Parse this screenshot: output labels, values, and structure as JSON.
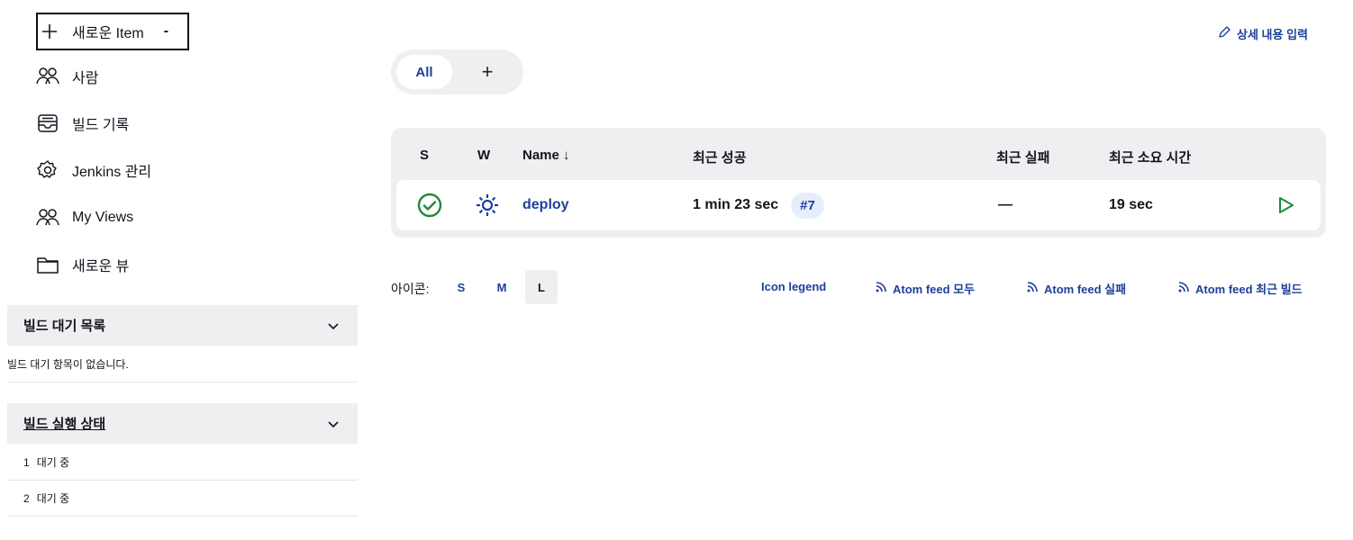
{
  "sidebar": {
    "tasks": [
      {
        "label": "새로운 Item",
        "icon": "plus-icon",
        "caret": "-"
      },
      {
        "label": "사람",
        "icon": "people-icon"
      },
      {
        "label": "빌드 기록",
        "icon": "inbox-icon"
      },
      {
        "label": "Jenkins 관리",
        "icon": "gear-icon"
      },
      {
        "label": "My Views",
        "icon": "people-icon"
      },
      {
        "label": "새로운 뷰",
        "icon": "folder-icon"
      }
    ],
    "build_queue": {
      "title": "빌드 대기 목록",
      "empty_text": "빌드 대기 항목이 없습니다."
    },
    "executors": {
      "title": "빌드 실행 상태",
      "rows": [
        {
          "num": "1",
          "label": "대기 중"
        },
        {
          "num": "2",
          "label": "대기 중"
        }
      ]
    }
  },
  "main": {
    "edit_description": "상세 내용 입력",
    "tabs": {
      "all": "All",
      "add": "+"
    },
    "table": {
      "headers": {
        "s": "S",
        "w": "W",
        "name": "Name ↓",
        "last_success": "최근 성공",
        "last_failure": "최근 실패",
        "last_duration": "최근 소요 시간"
      },
      "rows": [
        {
          "status_icon": "success-check-icon",
          "weather_icon": "sunny-icon",
          "name": "deploy",
          "last_success": "1 min 23 sec",
          "last_success_build": "#7",
          "last_failure": "—",
          "last_duration": "19 sec",
          "action_icon": "play-icon"
        }
      ]
    },
    "icon_bar": {
      "label": "아이콘:",
      "sizes": [
        "S",
        "M",
        "L"
      ],
      "active_size": "L",
      "legend": "Icon legend",
      "feeds": [
        "Atom feed 모두",
        "Atom feed 실패",
        "Atom feed 최근 빌드"
      ]
    }
  },
  "colors": {
    "link": "#1e3f9c",
    "success": "#1e8a3e",
    "panel_bg": "#efeff1",
    "text": "#14141f"
  }
}
